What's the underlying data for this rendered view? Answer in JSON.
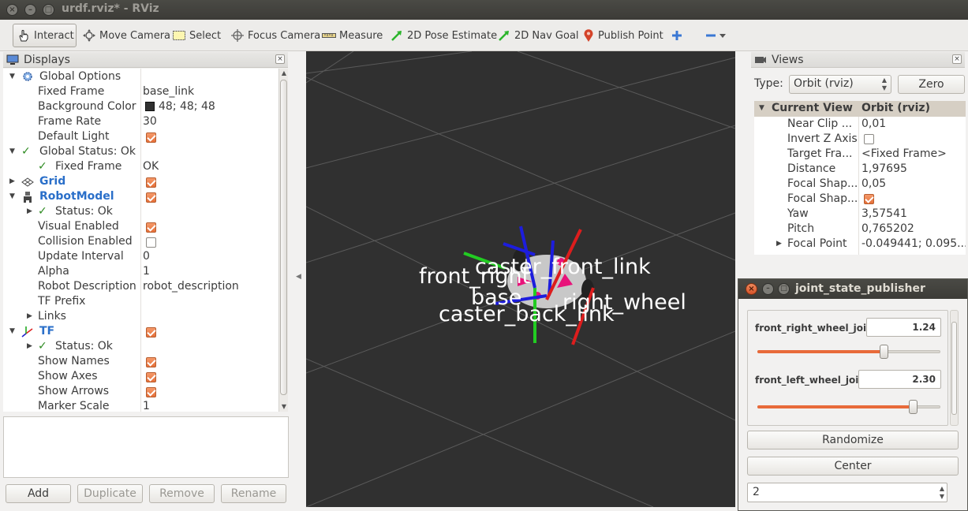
{
  "window": {
    "title": "urdf.rviz* - RViz"
  },
  "toolbar": {
    "interact": "Interact",
    "move_camera": "Move Camera",
    "select": "Select",
    "focus_camera": "Focus Camera",
    "measure": "Measure",
    "pose_estimate": "2D Pose Estimate",
    "nav_goal": "2D Nav Goal",
    "publish_point": "Publish Point"
  },
  "displays": {
    "title": "Displays",
    "rows": [
      {
        "key": "Global Options",
        "value": ""
      },
      {
        "key": "Fixed Frame",
        "value": "base_link"
      },
      {
        "key": "Background Color",
        "value": "48; 48; 48"
      },
      {
        "key": "Frame Rate",
        "value": "30"
      },
      {
        "key": "Default Light",
        "value": ""
      },
      {
        "key": "Global Status: Ok",
        "value": ""
      },
      {
        "key": "Fixed Frame",
        "value": "OK"
      },
      {
        "key": "Grid",
        "value": ""
      },
      {
        "key": "RobotModel",
        "value": ""
      },
      {
        "key": "Status: Ok",
        "value": ""
      },
      {
        "key": "Visual Enabled",
        "value": ""
      },
      {
        "key": "Collision Enabled",
        "value": ""
      },
      {
        "key": "Update Interval",
        "value": "0"
      },
      {
        "key": "Alpha",
        "value": "1"
      },
      {
        "key": "Robot Description",
        "value": "robot_description"
      },
      {
        "key": "TF Prefix",
        "value": ""
      },
      {
        "key": "Links",
        "value": ""
      },
      {
        "key": "TF",
        "value": ""
      },
      {
        "key": "Status: Ok",
        "value": ""
      },
      {
        "key": "Show Names",
        "value": ""
      },
      {
        "key": "Show Axes",
        "value": ""
      },
      {
        "key": "Show Arrows",
        "value": ""
      },
      {
        "key": "Marker Scale",
        "value": "1"
      }
    ],
    "buttons": {
      "add": "Add",
      "duplicate": "Duplicate",
      "remove": "Remove",
      "rename": "Rename"
    }
  },
  "viewport": {
    "labels": {
      "front_right": "front_right",
      "caster_front_link": "caster_front_link",
      "base": "base",
      "right_wheel": "right_wheel",
      "caster_back_link": "caster_back_link"
    }
  },
  "views": {
    "title": "Views",
    "type_label": "Type:",
    "type_value": "Orbit (rviz)",
    "zero": "Zero",
    "header_key": "Current View",
    "header_value": "Orbit (rviz)",
    "rows": [
      {
        "key": "Near Clip ...",
        "value": "0,01"
      },
      {
        "key": "Invert Z Axis",
        "value": ""
      },
      {
        "key": "Target Fra...",
        "value": "<Fixed Frame>"
      },
      {
        "key": "Distance",
        "value": "1,97695"
      },
      {
        "key": "Focal Shap...",
        "value": "0,05"
      },
      {
        "key": "Focal Shap...",
        "value": ""
      },
      {
        "key": "Yaw",
        "value": "3,57541"
      },
      {
        "key": "Pitch",
        "value": "0,765202"
      },
      {
        "key": "Focal Point",
        "value": "-0.049441; 0.095..."
      }
    ]
  },
  "jsp": {
    "title": "joint_state_publisher",
    "joints": [
      {
        "name": "front_right_wheel_joint",
        "value": "1.24",
        "fraction": 0.7
      },
      {
        "name": "front_left_wheel_joint",
        "value": "2.30",
        "fraction": 0.85
      }
    ],
    "randomize": "Randomize",
    "center": "Center",
    "spin_value": "2"
  },
  "colors": {
    "bg_swatch": "#303030",
    "accent": "#e86a3a"
  }
}
